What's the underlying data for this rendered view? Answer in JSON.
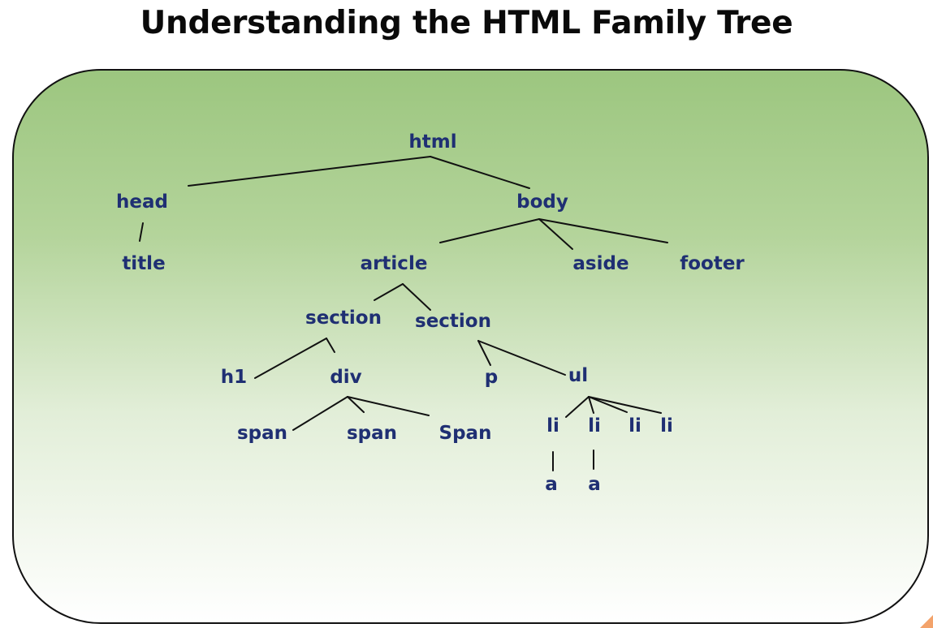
{
  "title": "Understanding the HTML Family Tree",
  "colors": {
    "panel_top": "#9cc67f",
    "panel_bottom": "#ffffff",
    "label": "#1f2f73",
    "edge": "#111111"
  },
  "nodes": {
    "html": "html",
    "head": "head",
    "body": "body",
    "title": "title",
    "article": "article",
    "aside": "aside",
    "footer": "footer",
    "section_1": "section",
    "section_2": "section",
    "h1": "h1",
    "div": "div",
    "p": "p",
    "ul": "ul",
    "span_1": "span",
    "span_2": "span",
    "span_3": "Span",
    "li_1": "li",
    "li_2": "li",
    "li_3": "li",
    "li_4": "li",
    "a_1": "a",
    "a_2": "a"
  },
  "edges": [
    [
      "html",
      "head"
    ],
    [
      "html",
      "body"
    ],
    [
      "head",
      "title"
    ],
    [
      "body",
      "article"
    ],
    [
      "body",
      "aside"
    ],
    [
      "body",
      "footer"
    ],
    [
      "article",
      "section_1"
    ],
    [
      "article",
      "section_2"
    ],
    [
      "section_1",
      "h1"
    ],
    [
      "section_1",
      "div"
    ],
    [
      "section_2",
      "p"
    ],
    [
      "section_2",
      "ul"
    ],
    [
      "div",
      "span_1"
    ],
    [
      "div",
      "span_2"
    ],
    [
      "div",
      "span_3"
    ],
    [
      "ul",
      "li_1"
    ],
    [
      "ul",
      "li_2"
    ],
    [
      "ul",
      "li_3"
    ],
    [
      "ul",
      "li_4"
    ],
    [
      "li_1",
      "a_1"
    ],
    [
      "li_2",
      "a_2"
    ]
  ]
}
